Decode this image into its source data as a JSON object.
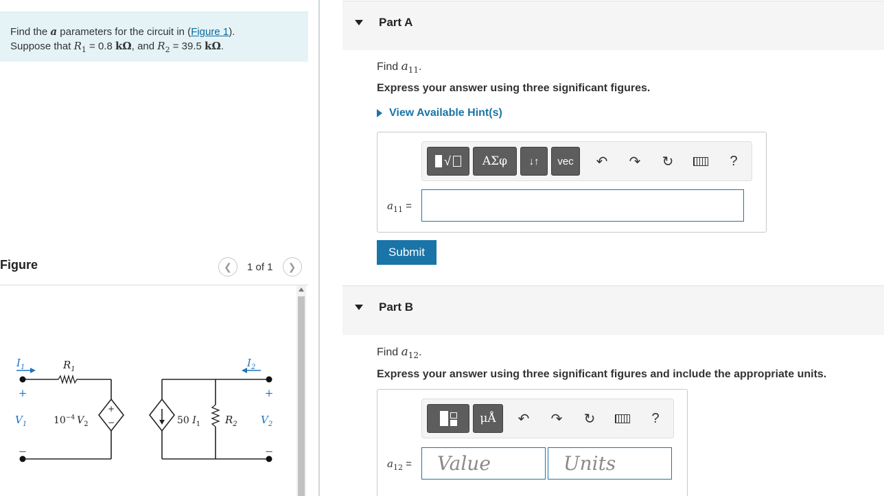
{
  "problem": {
    "line1_pre": "Find the ",
    "line1_param": "a",
    "line1_mid": " parameters for the circuit in (",
    "figure_link": "Figure 1",
    "line1_post": ").",
    "line2_pre": "Suppose that ",
    "r1_sym": "R",
    "r1_sub": "1",
    "r1_value": " = 0.8 ",
    "r1_unit": "kΩ",
    "mid": ", and ",
    "r2_sym": "R",
    "r2_sub": "2",
    "r2_value": " = 39.5 ",
    "r2_unit": "kΩ",
    "end": "."
  },
  "figure": {
    "title": "Figure",
    "pager_text": "1 of 1",
    "prev_icon": "chevron-left-icon",
    "next_icon": "chevron-right-icon"
  },
  "circuit": {
    "i1": "I",
    "i1_sub": "1",
    "r1": "R",
    "r1_sub": "1",
    "i2": "I",
    "i2_sub": "2",
    "v1": "V",
    "v1_sub": "1",
    "v2": "V",
    "v2_sub": "2",
    "dep_vs_coef": "10",
    "dep_vs_exp": "−4",
    "dep_vs_var": "V",
    "dep_vs_sub": "2",
    "dep_cs_coef": "50 ",
    "dep_cs_var": "I",
    "dep_cs_sub": "1",
    "r2": "R",
    "r2_sub": "2",
    "plus": "+",
    "minus": "−"
  },
  "partA": {
    "title": "Part A",
    "find_pre": "Find ",
    "find_var": "a",
    "find_sub": "11",
    "find_post": ".",
    "express": "Express your answer using three significant figures.",
    "hint": "View Available Hint(s)",
    "toolbar": {
      "template_icon": "fraction-sqrt-template-icon",
      "greek_label": "ΑΣφ",
      "arrows_label": "↓↑",
      "vec_label": "vec",
      "undo_icon": "undo-icon",
      "redo_icon": "redo-icon",
      "reset_icon": "reset-icon",
      "keyboard_icon": "keyboard-icon",
      "help_label": "?"
    },
    "input_var": "a",
    "input_sub": "11",
    "input_eq": " =",
    "input_value": "",
    "submit": "Submit"
  },
  "partB": {
    "title": "Part B",
    "find_pre": "Find ",
    "find_var": "a",
    "find_sub": "12",
    "find_post": ".",
    "express": "Express your answer using three significant figures and include the appropriate units.",
    "toolbar": {
      "template_icon": "value-units-template-icon",
      "units_label": "μÅ",
      "undo_icon": "undo-icon",
      "redo_icon": "redo-icon",
      "reset_icon": "reset-icon",
      "keyboard_icon": "keyboard-icon",
      "help_label": "?"
    },
    "input_var": "a",
    "input_sub": "12",
    "input_eq": " =",
    "value_placeholder": "Value",
    "units_placeholder": "Units"
  }
}
